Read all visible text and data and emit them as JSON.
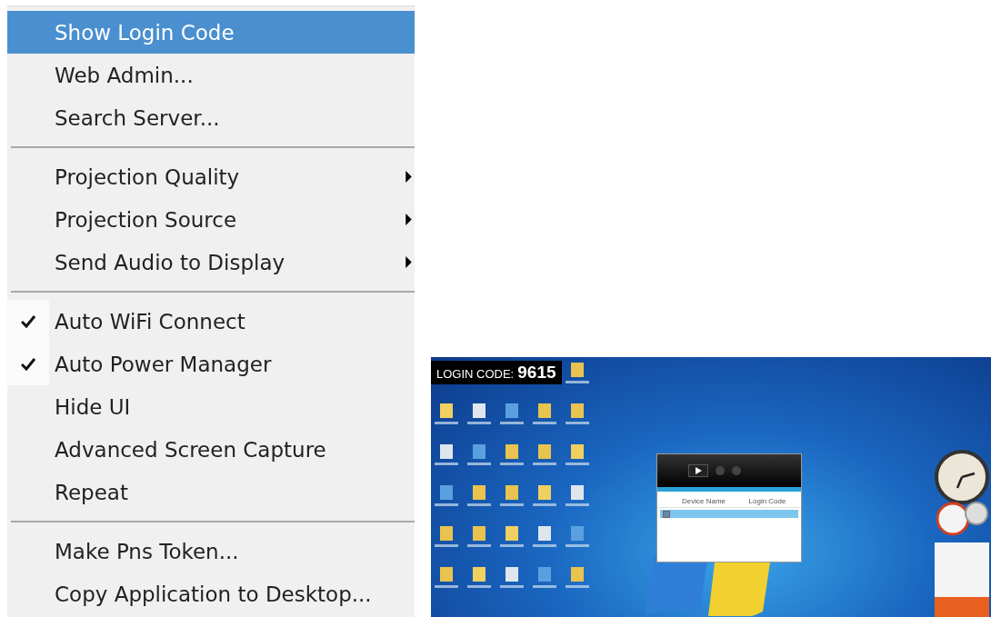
{
  "menu": {
    "sections": [
      {
        "items": [
          {
            "label": "Show Login Code",
            "selected": true,
            "checked": false,
            "submenu": false
          },
          {
            "label": "Web Admin...",
            "selected": false,
            "checked": false,
            "submenu": false
          },
          {
            "label": "Search Server...",
            "selected": false,
            "checked": false,
            "submenu": false
          }
        ]
      },
      {
        "items": [
          {
            "label": "Projection Quality",
            "selected": false,
            "checked": false,
            "submenu": true
          },
          {
            "label": "Projection Source",
            "selected": false,
            "checked": false,
            "submenu": true
          },
          {
            "label": "Send Audio to Display",
            "selected": false,
            "checked": false,
            "submenu": true
          }
        ]
      },
      {
        "items": [
          {
            "label": "Auto WiFi Connect",
            "selected": false,
            "checked": true,
            "submenu": false
          },
          {
            "label": "Auto Power Manager",
            "selected": false,
            "checked": true,
            "submenu": false
          },
          {
            "label": "Hide UI",
            "selected": false,
            "checked": false,
            "submenu": false
          },
          {
            "label": "Advanced Screen Capture",
            "selected": false,
            "checked": false,
            "submenu": false
          },
          {
            "label": "Repeat",
            "selected": false,
            "checked": false,
            "submenu": false
          }
        ]
      },
      {
        "items": [
          {
            "label": "Make Pns Token...",
            "selected": false,
            "checked": false,
            "submenu": false
          },
          {
            "label": "Copy Application to Desktop...",
            "selected": false,
            "checked": false,
            "submenu": false
          }
        ]
      }
    ]
  },
  "desktop": {
    "login_banner": {
      "label": "LOGIN CODE:",
      "code": "9615"
    },
    "player_window": {
      "columns": [
        "Device Name",
        "Login Code"
      ],
      "rows": [
        {
          "selected": true,
          "checked": true
        }
      ]
    }
  }
}
